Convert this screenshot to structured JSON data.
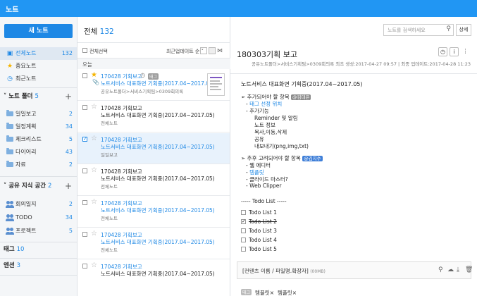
{
  "app": {
    "title": "노트"
  },
  "sidebar": {
    "new_note": "새 노트",
    "nav": [
      {
        "label": "전체노트",
        "count": "132",
        "icon": "notes-icon"
      },
      {
        "label": "중요노트",
        "count": "",
        "icon": "star-icon"
      },
      {
        "label": "최근노트",
        "count": "",
        "icon": "clock-icon"
      }
    ],
    "folder_section": {
      "label": "노트 폴더",
      "count": "5"
    },
    "folders": [
      {
        "label": "일일보고",
        "count": "2"
      },
      {
        "label": "일정계획",
        "count": "34"
      },
      {
        "label": "체크리스트",
        "count": "5"
      },
      {
        "label": "다이어리",
        "count": "43"
      },
      {
        "label": "자료",
        "count": "2"
      }
    ],
    "shared_section": {
      "label": "공유 지식 공간",
      "count": "2"
    },
    "shared": [
      {
        "label": "회의일지",
        "count": "2"
      },
      {
        "label": "TODO",
        "count": "34"
      },
      {
        "label": "프로젝트",
        "count": "5"
      }
    ],
    "tag_section": {
      "label": "태그",
      "count": "10"
    },
    "edition_section": {
      "label": "엔션",
      "count": "3"
    }
  },
  "list": {
    "header_label": "전체",
    "header_count": "132",
    "select_all": "전체선택",
    "sort_label": "최근업데이트 순",
    "day_label": "오늘",
    "notes": [
      {
        "title": "170428 기획보고",
        "subtitle": "노트서비스 대표화면 기획중(2017.04~2017.05)",
        "meta": "공유노트폴더>서비스기획팀>0309회의록",
        "starred": true,
        "checked": false,
        "tag": "태그",
        "title_blue": true,
        "sub_blue": true
      },
      {
        "title": "170428 기획보고",
        "subtitle": "노트서비스 대표화면 기획중(2017.04~2017.05)",
        "meta": "전체노트",
        "starred": false,
        "checked": false,
        "tag": "",
        "title_blue": false,
        "sub_blue": false
      },
      {
        "title": "170428 기획보고",
        "subtitle": "노트서비스 대표화면 기획중(2017.04~2017.05)",
        "meta": "일일보고",
        "starred": false,
        "checked": true,
        "tag": "",
        "title_blue": true,
        "sub_blue": true
      },
      {
        "title": "170428 기획보고",
        "subtitle": "노트서비스 대표화면 기획중(2017.04~2017.05)",
        "meta": "전체노트",
        "starred": false,
        "checked": false,
        "tag": "",
        "title_blue": false,
        "sub_blue": false
      },
      {
        "title": "170428 기획보고",
        "subtitle": "노트서비스 대표화면 기획중(2017.04~2017.05)",
        "meta": "전체노트",
        "starred": false,
        "checked": false,
        "tag": "",
        "title_blue": true,
        "sub_blue": true
      },
      {
        "title": "170428 기획보고",
        "subtitle": "노트서비스 대표화면 기획중(2017.04~2017.05)",
        "meta": "전체노트",
        "starred": false,
        "checked": false,
        "tag": "",
        "title_blue": true,
        "sub_blue": true
      },
      {
        "title": "170428 기획보고",
        "subtitle": "노트서비스 대표화면 기획중(2017.04~2017.05)",
        "meta": "",
        "starred": false,
        "checked": false,
        "tag": "",
        "title_blue": true,
        "sub_blue": false
      }
    ]
  },
  "search": {
    "placeholder": "노트를 검색하세요",
    "detail_button": "상세"
  },
  "detail": {
    "title": "180303기획 보고",
    "meta": "공유노트폴더>서비스기획팀>0309회의록   최초 생성:2017-04-27 09:57  |  최종 업데이트:2017-04-28 11:23",
    "heading": "노트서비스 대표화면 기획중(2017.04~2017.05)",
    "section1": {
      "title": "추가되어야 할 항목",
      "badge": "@김대은"
    },
    "s1_items": [
      "태그 선정 위치",
      "추가기능"
    ],
    "s1_sub": [
      "Reminder 및 알림",
      "노트 정보",
      "복사,이동,삭제",
      "공유",
      "내보내기(png,img,txt)"
    ],
    "section2": {
      "title": "추후 고려되어야 할 항목",
      "badge": "@김지수"
    },
    "s2_items": [
      "웹 에디터",
      "템플릿",
      "클라이드 마스터?",
      "Web Clipper"
    ],
    "todo_title": "----- Todo List -----",
    "todos": [
      "Todo List 1",
      "Todo List 2",
      "Todo List 3",
      "Todo List 4",
      "Todo List 5"
    ],
    "attachment": {
      "name": "[컨텐츠 이름 / 파일명.확장자]",
      "size": "(00MB)"
    },
    "tags": [
      "템플릿",
      "템플릿"
    ],
    "tag_label": "태그"
  }
}
